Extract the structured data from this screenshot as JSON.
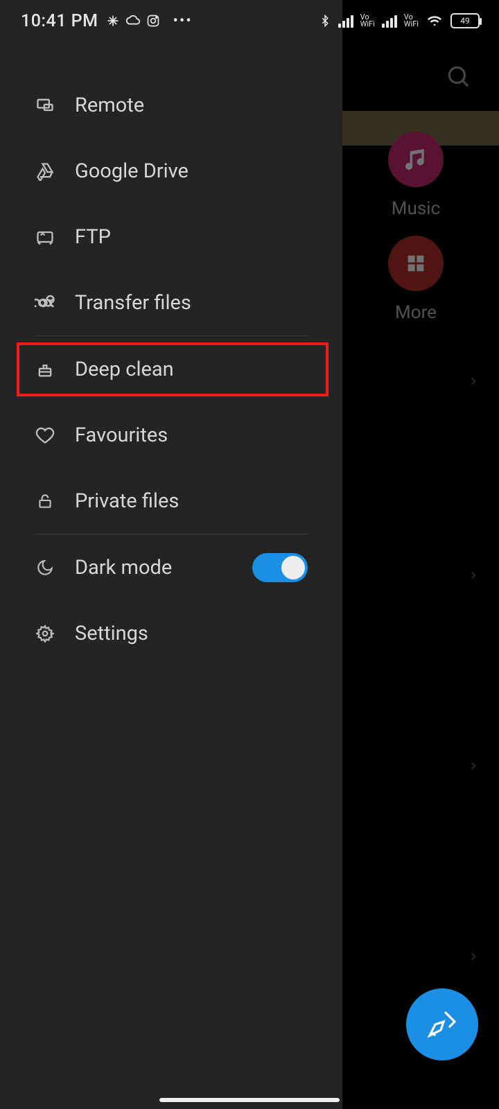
{
  "status": {
    "time": "10:41 PM",
    "battery_level": "49"
  },
  "drawer": {
    "items": {
      "remote": {
        "label": "Remote"
      },
      "gdrive": {
        "label": "Google Drive"
      },
      "ftp": {
        "label": "FTP"
      },
      "transfer": {
        "label": "Transfer files"
      },
      "deep_clean": {
        "label": "Deep clean"
      },
      "favourites": {
        "label": "Favourites"
      },
      "private": {
        "label": "Private files"
      },
      "dark_mode": {
        "label": "Dark mode",
        "enabled": true
      },
      "settings": {
        "label": "Settings"
      }
    },
    "highlighted": "deep_clean"
  },
  "background": {
    "tiles": {
      "music": {
        "label": "Music"
      },
      "more": {
        "label": "More"
      }
    }
  },
  "colors": {
    "accent": "#1a8fe3",
    "highlight_border": "#ef1c1c",
    "drawer_bg": "#242424",
    "tile_music": "#c6286f",
    "tile_more": "#b12f2a"
  }
}
